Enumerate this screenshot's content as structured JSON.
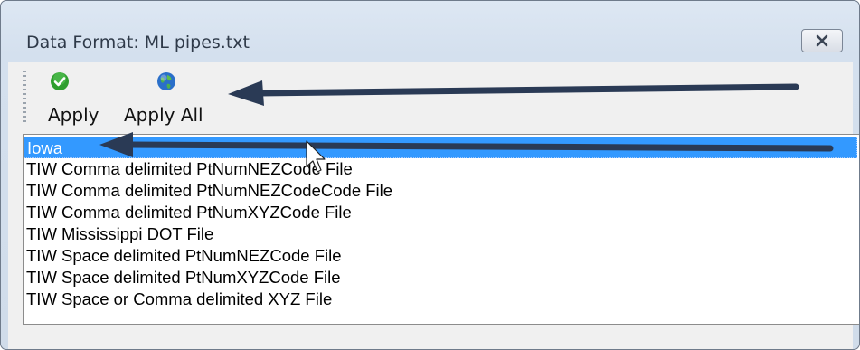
{
  "window": {
    "title": "Data Format: ML pipes.txt"
  },
  "toolbar": {
    "apply_label": "Apply",
    "apply_all_label": "Apply All"
  },
  "format_list": {
    "selected_index": 0,
    "items": [
      "Iowa",
      "TIW Comma delimited PtNumNEZCode File",
      "TIW Comma delimited PtNumNEZCodeCode File",
      "TIW Comma delimited PtNumXYZCode File",
      "TIW Mississippi DOT File",
      "TIW Space delimited PtNumNEZCode File",
      "TIW Space delimited PtNumXYZCode File",
      "TIW Space or Comma delimited XYZ File"
    ]
  },
  "colors": {
    "selection": "#3399ff",
    "annotation_arrow": "#2a3a55"
  }
}
